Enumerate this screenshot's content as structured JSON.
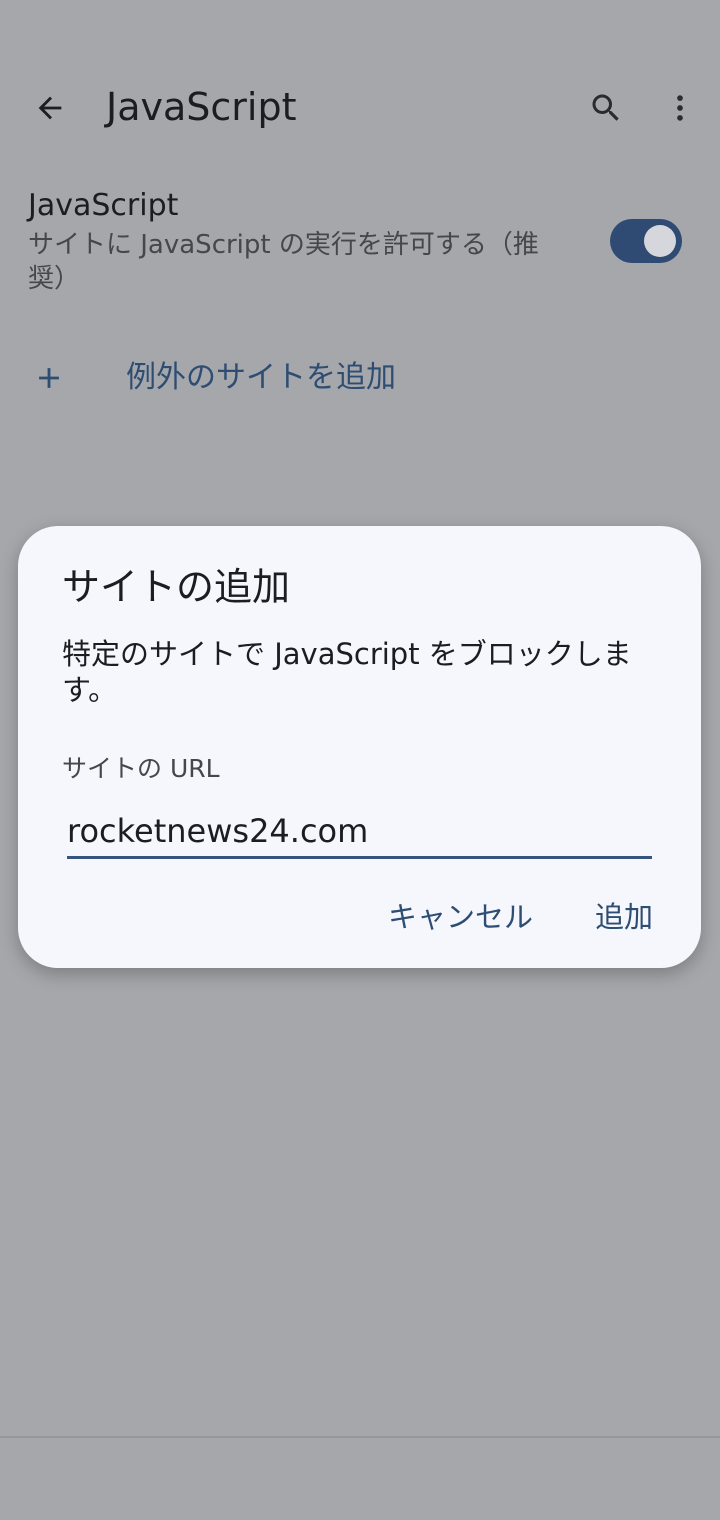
{
  "appbar": {
    "title": "JavaScript",
    "back_icon": "arrow-left-icon",
    "search_icon": "search-icon",
    "more_icon": "more-vert-icon"
  },
  "setting": {
    "title": "JavaScript",
    "description": "サイトに JavaScript の実行を許可する（推奨）",
    "enabled": true
  },
  "add_exception": {
    "label": "例外のサイトを追加",
    "icon": "plus-icon"
  },
  "dialog": {
    "title": "サイトの追加",
    "message": "特定のサイトで JavaScript をブロックします。",
    "field_label": "サイトの URL",
    "url_value": "rocketnews24.com",
    "cancel_label": "キャンセル",
    "add_label": "追加"
  },
  "colors": {
    "accent": "#2e4d72",
    "scrim": "#a6a7ab",
    "dialog_bg": "#f5f7fc"
  }
}
